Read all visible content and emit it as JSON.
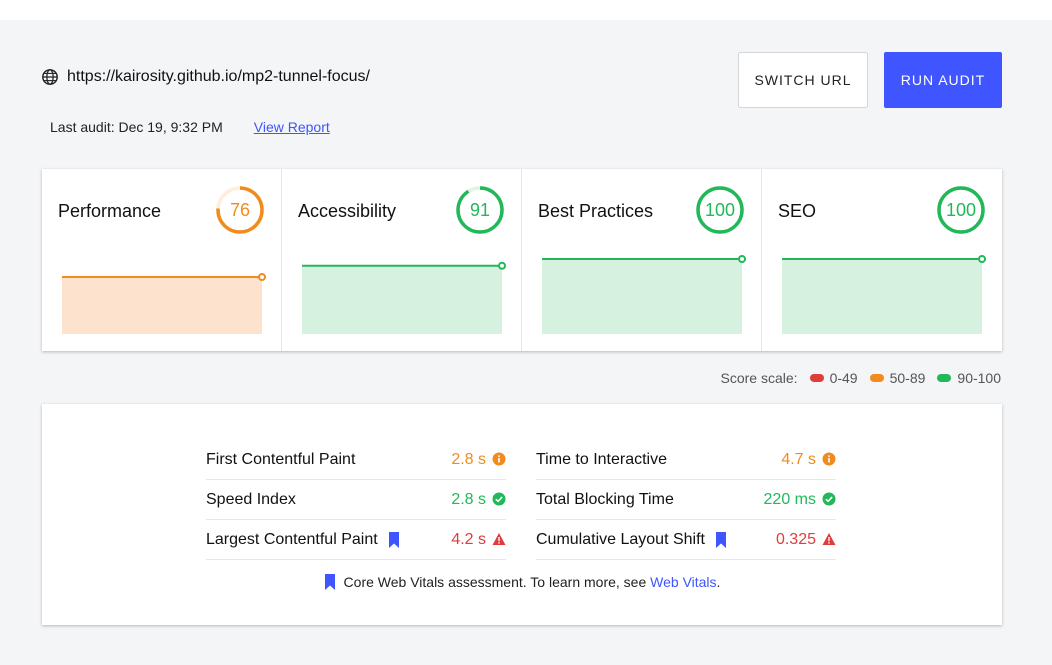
{
  "header": {
    "url": "https://kairosity.github.io/mp2-tunnel-focus/",
    "last_audit_label": "Last audit: Dec 19, 9:32 PM",
    "view_report_label": "View Report",
    "switch_url_label": "SWITCH URL",
    "run_audit_label": "RUN AUDIT"
  },
  "colors": {
    "accent": "#3e55ff",
    "good": "#22b85a",
    "average": "#f28b1e",
    "poor": "#e03c3c",
    "good_fill": "#d6f1e0",
    "average_fill": "#fde3cd"
  },
  "cards": [
    {
      "title": "Performance",
      "score": "76",
      "score_value": 76,
      "status": "average"
    },
    {
      "title": "Accessibility",
      "score": "91",
      "score_value": 91,
      "status": "good"
    },
    {
      "title": "Best Practices",
      "score": "100",
      "score_value": 100,
      "status": "good"
    },
    {
      "title": "SEO",
      "score": "100",
      "score_value": 100,
      "status": "good"
    }
  ],
  "score_scale": {
    "label": "Score scale:",
    "ranges": [
      {
        "label": "0-49",
        "color": "#e03c3c"
      },
      {
        "label": "50-89",
        "color": "#f28b1e"
      },
      {
        "label": "90-100",
        "color": "#22b85a"
      }
    ]
  },
  "metrics": {
    "left": [
      {
        "label": "First Contentful Paint",
        "value": "2.8 s",
        "status": "average",
        "core": false
      },
      {
        "label": "Speed Index",
        "value": "2.8 s",
        "status": "good",
        "core": false
      },
      {
        "label": "Largest Contentful Paint",
        "value": "4.2 s",
        "status": "poor",
        "core": true
      }
    ],
    "right": [
      {
        "label": "Time to Interactive",
        "value": "4.7 s",
        "status": "average",
        "core": false
      },
      {
        "label": "Total Blocking Time",
        "value": "220 ms",
        "status": "good",
        "core": false
      },
      {
        "label": "Cumulative Layout Shift",
        "value": "0.325",
        "status": "poor",
        "core": true
      }
    ]
  },
  "footnote": {
    "text": "Core Web Vitals assessment. To learn more, see",
    "link_label": "Web Vitals",
    "trailing": "."
  }
}
